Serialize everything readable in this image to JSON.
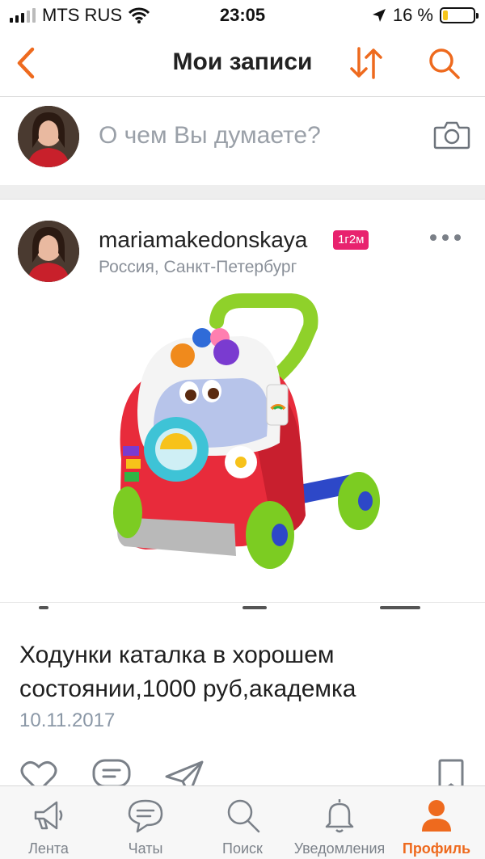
{
  "status_bar": {
    "carrier": "MTS RUS",
    "time": "23:05",
    "battery_text": "16 %",
    "battery_level": 0.16
  },
  "header": {
    "title": "Мои записи",
    "accent_color": "#ee6a1e"
  },
  "composer": {
    "placeholder": "О чем Вы думаете?"
  },
  "post": {
    "author": "mariamakedonskaya",
    "badge": "1г2м",
    "location": "Россия, Санкт-Петербург",
    "text": "Ходунки каталка в хорошем состоянии,1000 руб,академка",
    "date": "10.11.2017"
  },
  "tabs": [
    {
      "label": "Лента",
      "icon": "megaphone-icon",
      "active": false
    },
    {
      "label": "Чаты",
      "icon": "chat-bubble-icon",
      "active": false
    },
    {
      "label": "Поиск",
      "icon": "search-icon",
      "active": false
    },
    {
      "label": "Уведомления",
      "icon": "bell-icon",
      "active": false
    },
    {
      "label": "Профиль",
      "icon": "profile-icon",
      "active": true
    }
  ]
}
